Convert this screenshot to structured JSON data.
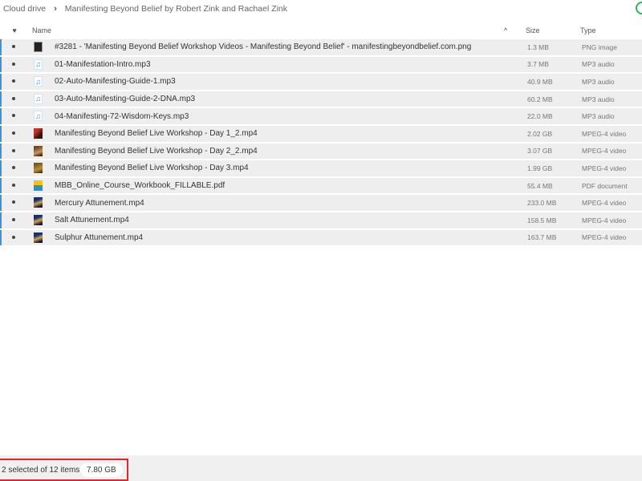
{
  "breadcrumb": {
    "root": "Cloud drive",
    "folder": "Manifesting Beyond Belief by Robert Zink and Rachael Zink"
  },
  "header": {
    "fav_icon": "heart-icon",
    "name": "Name",
    "sort_icon": "caret-up-icon",
    "size": "Size",
    "type": "Type"
  },
  "files": [
    {
      "name": "#3281 - 'Manifesting Beyond Belief Workshop Videos - Manifesting Beyond Belief' - manifestingbeyondbelief.com.png",
      "size": "1.3 MB",
      "type": "PNG image",
      "icon": "image-thumbnail"
    },
    {
      "name": "01-Manifestation-Intro.mp3",
      "size": "3.7 MB",
      "type": "MP3 audio",
      "icon": "audio-file-icon"
    },
    {
      "name": "02-Auto-Manifesting-Guide-1.mp3",
      "size": "40.9 MB",
      "type": "MP3 audio",
      "icon": "audio-file-icon"
    },
    {
      "name": "03-Auto-Manifesting-Guide-2-DNA.mp3",
      "size": "60.2 MB",
      "type": "MP3 audio",
      "icon": "audio-file-icon"
    },
    {
      "name": "04-Manifesting-72-Wisdom-Keys.mp3",
      "size": "22.0 MB",
      "type": "MP3 audio",
      "icon": "audio-file-icon"
    },
    {
      "name": "Manifesting Beyond Belief Live Workshop - Day 1_2.mp4",
      "size": "2.02 GB",
      "type": "MPEG-4 video",
      "icon": "video-thumbnail"
    },
    {
      "name": "Manifesting Beyond Belief Live Workshop - Day 2_2.mp4",
      "size": "3.07 GB",
      "type": "MPEG-4 video",
      "icon": "video-thumbnail"
    },
    {
      "name": "Manifesting Beyond Belief Live Workshop - Day 3.mp4",
      "size": "1.99 GB",
      "type": "MPEG-4 video",
      "icon": "video-thumbnail"
    },
    {
      "name": "MBB_Online_Course_Workbook_FILLABLE.pdf",
      "size": "55.4 MB",
      "type": "PDF document",
      "icon": "pdf-thumbnail"
    },
    {
      "name": "Mercury Attunement.mp4",
      "size": "233.0 MB",
      "type": "MPEG-4 video",
      "icon": "video-thumbnail"
    },
    {
      "name": "Salt Attunement.mp4",
      "size": "158.5 MB",
      "type": "MPEG-4 video",
      "icon": "video-thumbnail"
    },
    {
      "name": "Sulphur Attunement.mp4",
      "size": "163.7 MB",
      "type": "MPEG-4 video",
      "icon": "video-thumbnail"
    }
  ],
  "footer": {
    "selection_text": "2 selected of 12 items",
    "selection_total": "7.80 GB"
  },
  "colors": {
    "selection_outline": "#e0262e",
    "row_accent": "#4a90c8",
    "sync_indicator": "#2bb35e"
  }
}
